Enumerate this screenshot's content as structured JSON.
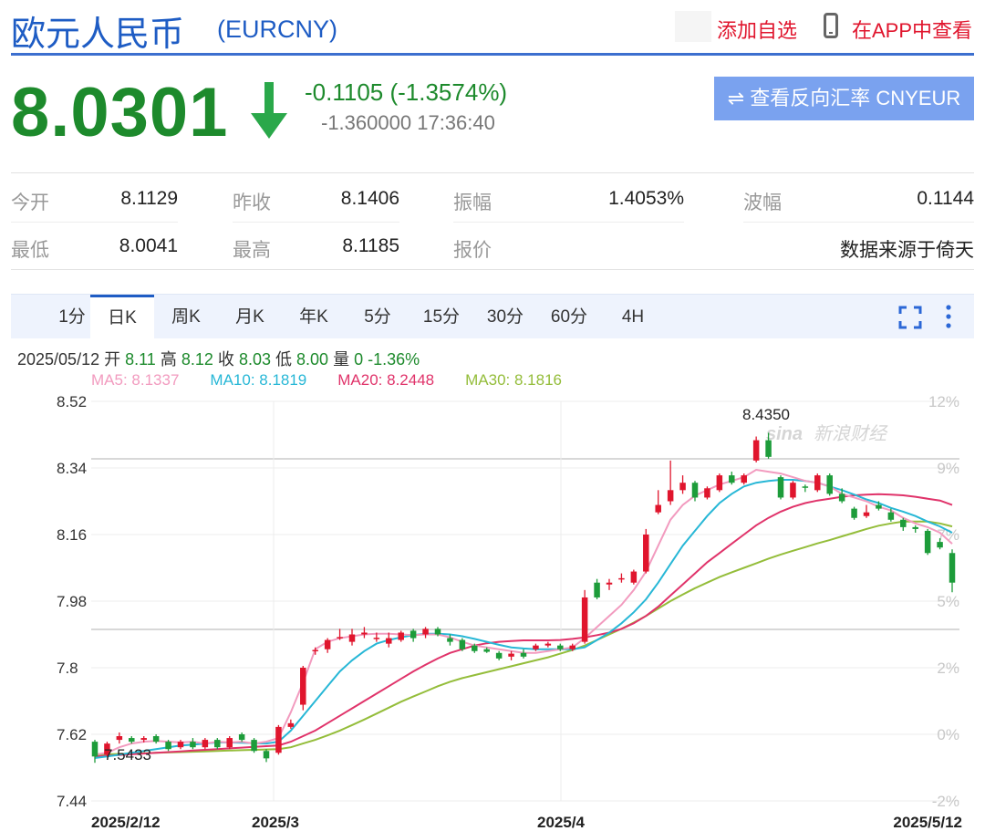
{
  "header": {
    "title": "欧元人民币",
    "code": "(EURCNY)",
    "add_watch": "添加自选",
    "app_view": "在APP中查看"
  },
  "quote": {
    "price": "8.0301",
    "change": "-0.1105 (-1.3574%)",
    "sub_change": "-1.360000",
    "time": "17:36:40",
    "reverse_button": "查看反向汇率 CNYEUR",
    "down_color": "#1d8a2c"
  },
  "stats": {
    "open_label": "今开",
    "open": "8.1129",
    "prev_close_label": "昨收",
    "prev_close": "8.1406",
    "amplitude_label": "振幅",
    "amplitude": "1.4053%",
    "wave_label": "波幅",
    "wave": "0.1144",
    "low_label": "最低",
    "low": "8.0041",
    "high_label": "最高",
    "high": "8.1185",
    "quote_label": "报价",
    "source": "数据来源于倚天"
  },
  "tabs": [
    {
      "label": "1分"
    },
    {
      "label": "日K",
      "active": true
    },
    {
      "label": "周K"
    },
    {
      "label": "月K"
    },
    {
      "label": "年K"
    },
    {
      "label": "5分"
    },
    {
      "label": "15分"
    },
    {
      "label": "30分"
    },
    {
      "label": "60分"
    },
    {
      "label": "4H"
    }
  ],
  "info": {
    "date": "2025/05/12",
    "open_label": "开",
    "open": "8.11",
    "high_label": "高",
    "high": "8.12",
    "close_label": "收",
    "close": "8.03",
    "low_label": "低",
    "low": "8.00",
    "vol_label": "量",
    "vol": "0",
    "pct": "-1.36%"
  },
  "ma": [
    {
      "label": "MA5: 8.1337",
      "color": "#f29bbf"
    },
    {
      "label": "MA10: 8.1819",
      "color": "#27b7d6"
    },
    {
      "label": "MA20: 8.2448",
      "color": "#e0336a"
    },
    {
      "label": "MA30: 8.1816",
      "color": "#94bd3a"
    }
  ],
  "watermark": "新浪财经",
  "chart_data": {
    "type": "candlestick",
    "up_color": "#e0152d",
    "down_color": "#1d9c3a",
    "y_ticks": [
      "8.52",
      "8.34",
      "8.16",
      "7.98",
      "7.8",
      "7.62",
      "7.44"
    ],
    "pct_ticks": [
      "12%",
      "9%",
      "7%",
      "5%",
      "2%",
      "0%",
      "-2%"
    ],
    "x_ticks": [
      "2025/2/12",
      "2025/3",
      "2025/4",
      "2025/5/12"
    ],
    "ylim": [
      7.44,
      8.52
    ],
    "high_label": "8.4350",
    "low_label": "7.5433",
    "candles": [
      [
        7.6,
        7.56,
        7.605,
        7.543
      ],
      [
        7.565,
        7.595,
        7.6,
        7.56
      ],
      [
        7.605,
        7.615,
        7.625,
        7.595
      ],
      [
        7.61,
        7.6,
        7.615,
        7.595
      ],
      [
        7.605,
        7.61,
        7.615,
        7.598
      ],
      [
        7.615,
        7.6,
        7.62,
        7.595
      ],
      [
        7.6,
        7.58,
        7.605,
        7.575
      ],
      [
        7.585,
        7.6,
        7.605,
        7.58
      ],
      [
        7.6,
        7.585,
        7.61,
        7.58
      ],
      [
        7.585,
        7.605,
        7.61,
        7.58
      ],
      [
        7.605,
        7.585,
        7.61,
        7.58
      ],
      [
        7.585,
        7.61,
        7.615,
        7.58
      ],
      [
        7.62,
        7.605,
        7.625,
        7.6
      ],
      [
        7.605,
        7.575,
        7.61,
        7.57
      ],
      [
        7.575,
        7.555,
        7.58,
        7.545
      ],
      [
        7.57,
        7.64,
        7.645,
        7.565
      ],
      [
        7.64,
        7.65,
        7.66,
        7.635
      ],
      [
        7.7,
        7.8,
        7.805,
        7.685
      ],
      [
        7.845,
        7.848,
        7.855,
        7.835
      ],
      [
        7.85,
        7.875,
        7.88,
        7.84
      ],
      [
        7.88,
        7.883,
        7.905,
        7.875
      ],
      [
        7.87,
        7.89,
        7.905,
        7.86
      ],
      [
        7.89,
        7.895,
        7.91,
        7.88
      ],
      [
        7.88,
        7.881,
        7.895,
        7.87
      ],
      [
        7.865,
        7.88,
        7.895,
        7.855
      ],
      [
        7.875,
        7.895,
        7.9,
        7.87
      ],
      [
        7.9,
        7.88,
        7.905,
        7.87
      ],
      [
        7.89,
        7.905,
        7.91,
        7.88
      ],
      [
        7.905,
        7.89,
        7.91,
        7.885
      ],
      [
        7.88,
        7.87,
        7.89,
        7.86
      ],
      [
        7.875,
        7.85,
        7.88,
        7.845
      ],
      [
        7.86,
        7.845,
        7.865,
        7.84
      ],
      [
        7.85,
        7.843,
        7.855,
        7.84
      ],
      [
        7.84,
        7.825,
        7.845,
        7.82
      ],
      [
        7.83,
        7.838,
        7.845,
        7.82
      ],
      [
        7.84,
        7.83,
        7.85,
        7.825
      ],
      [
        7.85,
        7.86,
        7.865,
        7.845
      ],
      [
        7.86,
        7.865,
        7.87,
        7.855
      ],
      [
        7.86,
        7.85,
        7.865,
        7.845
      ],
      [
        7.85,
        7.86,
        7.865,
        7.845
      ],
      [
        7.87,
        7.99,
        8.01,
        7.865
      ],
      [
        8.03,
        7.99,
        8.04,
        7.985
      ],
      [
        8.025,
        8.03,
        8.04,
        8.01
      ],
      [
        8.04,
        8.042,
        8.055,
        8.03
      ],
      [
        8.03,
        8.06,
        8.065,
        8.025
      ],
      [
        8.06,
        8.16,
        8.175,
        8.055
      ],
      [
        8.22,
        8.24,
        8.28,
        8.215
      ],
      [
        8.25,
        8.28,
        8.36,
        8.24
      ],
      [
        8.28,
        8.3,
        8.32,
        8.27
      ],
      [
        8.3,
        8.26,
        8.305,
        8.25
      ],
      [
        8.26,
        8.285,
        8.29,
        8.255
      ],
      [
        8.28,
        8.32,
        8.325,
        8.275
      ],
      [
        8.32,
        8.3,
        8.33,
        8.295
      ],
      [
        8.3,
        8.32,
        8.325,
        8.295
      ],
      [
        8.36,
        8.415,
        8.425,
        8.355
      ],
      [
        8.415,
        8.37,
        8.435,
        8.365
      ],
      [
        8.315,
        8.26,
        8.32,
        8.255
      ],
      [
        8.26,
        8.3,
        8.305,
        8.255
      ],
      [
        8.29,
        8.288,
        8.295,
        8.275
      ],
      [
        8.28,
        8.32,
        8.325,
        8.275
      ],
      [
        8.32,
        8.27,
        8.325,
        8.265
      ],
      [
        8.27,
        8.25,
        8.285,
        8.245
      ],
      [
        8.23,
        8.205,
        8.235,
        8.2
      ],
      [
        8.21,
        8.22,
        8.24,
        8.205
      ],
      [
        8.24,
        8.23,
        8.25,
        8.225
      ],
      [
        8.22,
        8.2,
        8.23,
        8.195
      ],
      [
        8.2,
        8.18,
        8.205,
        8.17
      ],
      [
        8.18,
        8.175,
        8.185,
        8.165
      ],
      [
        8.17,
        8.11,
        8.175,
        8.105
      ],
      [
        8.14,
        8.125,
        8.15,
        8.12
      ],
      [
        8.11,
        8.03,
        8.12,
        8.004
      ]
    ],
    "ma5": [
      7.565,
      7.57,
      7.585,
      7.595,
      7.6,
      7.602,
      7.6,
      7.598,
      7.6,
      7.595,
      7.6,
      7.598,
      7.6,
      7.595,
      7.6,
      7.61,
      7.68,
      7.76,
      7.85,
      7.87,
      7.88,
      7.885,
      7.89,
      7.892,
      7.892,
      7.89,
      7.888,
      7.89,
      7.89,
      7.882,
      7.87,
      7.86,
      7.855,
      7.85,
      7.845,
      7.84,
      7.84,
      7.845,
      7.85,
      7.855,
      7.88,
      7.91,
      7.94,
      7.97,
      8.01,
      8.06,
      8.13,
      8.2,
      8.24,
      8.265,
      8.28,
      8.295,
      8.305,
      8.315,
      8.335,
      8.33,
      8.325,
      8.315,
      8.305,
      8.3,
      8.29,
      8.27,
      8.26,
      8.25,
      8.235,
      8.225,
      8.205,
      8.19,
      8.18,
      8.165,
      8.135
    ],
    "ma10": [
      7.556,
      7.56,
      7.565,
      7.57,
      7.575,
      7.58,
      7.585,
      7.59,
      7.592,
      7.595,
      7.598,
      7.598,
      7.597,
      7.596,
      7.595,
      7.6,
      7.63,
      7.67,
      7.71,
      7.75,
      7.79,
      7.82,
      7.845,
      7.865,
      7.875,
      7.882,
      7.888,
      7.892,
      7.892,
      7.89,
      7.885,
      7.878,
      7.87,
      7.862,
      7.855,
      7.852,
      7.85,
      7.85,
      7.85,
      7.85,
      7.855,
      7.875,
      7.895,
      7.92,
      7.95,
      7.985,
      8.03,
      8.08,
      8.13,
      8.17,
      8.21,
      8.245,
      8.27,
      8.29,
      8.3,
      8.305,
      8.308,
      8.308,
      8.305,
      8.3,
      8.29,
      8.28,
      8.268,
      8.255,
      8.245,
      8.232,
      8.222,
      8.21,
      8.195,
      8.182,
      8.165
    ],
    "ma20": [
      7.56,
      7.562,
      7.564,
      7.566,
      7.568,
      7.57,
      7.572,
      7.574,
      7.576,
      7.578,
      7.58,
      7.582,
      7.584,
      7.586,
      7.588,
      7.59,
      7.6,
      7.615,
      7.63,
      7.65,
      7.67,
      7.69,
      7.71,
      7.73,
      7.75,
      7.77,
      7.79,
      7.808,
      7.825,
      7.84,
      7.85,
      7.86,
      7.866,
      7.87,
      7.872,
      7.874,
      7.874,
      7.874,
      7.875,
      7.878,
      7.882,
      7.888,
      7.895,
      7.905,
      7.92,
      7.94,
      7.965,
      7.995,
      8.025,
      8.055,
      8.085,
      8.11,
      8.135,
      8.16,
      8.185,
      8.205,
      8.222,
      8.235,
      8.245,
      8.252,
      8.257,
      8.262,
      8.266,
      8.268,
      8.269,
      8.268,
      8.266,
      8.262,
      8.257,
      8.252,
      8.24
    ],
    "ma30": [
      7.565,
      7.566,
      7.567,
      7.568,
      7.569,
      7.57,
      7.571,
      7.572,
      7.573,
      7.574,
      7.575,
      7.576,
      7.577,
      7.578,
      7.579,
      7.58,
      7.585,
      7.595,
      7.605,
      7.617,
      7.63,
      7.645,
      7.66,
      7.676,
      7.692,
      7.708,
      7.722,
      7.736,
      7.75,
      7.762,
      7.772,
      7.78,
      7.788,
      7.796,
      7.804,
      7.812,
      7.82,
      7.828,
      7.838,
      7.848,
      7.86,
      7.875,
      7.89,
      7.905,
      7.922,
      7.94,
      7.96,
      7.98,
      7.998,
      8.015,
      8.03,
      8.045,
      8.058,
      8.07,
      8.082,
      8.095,
      8.106,
      8.116,
      8.126,
      8.136,
      8.145,
      8.155,
      8.165,
      8.175,
      8.184,
      8.19,
      8.195,
      8.195,
      8.195,
      8.19,
      8.182
    ]
  }
}
